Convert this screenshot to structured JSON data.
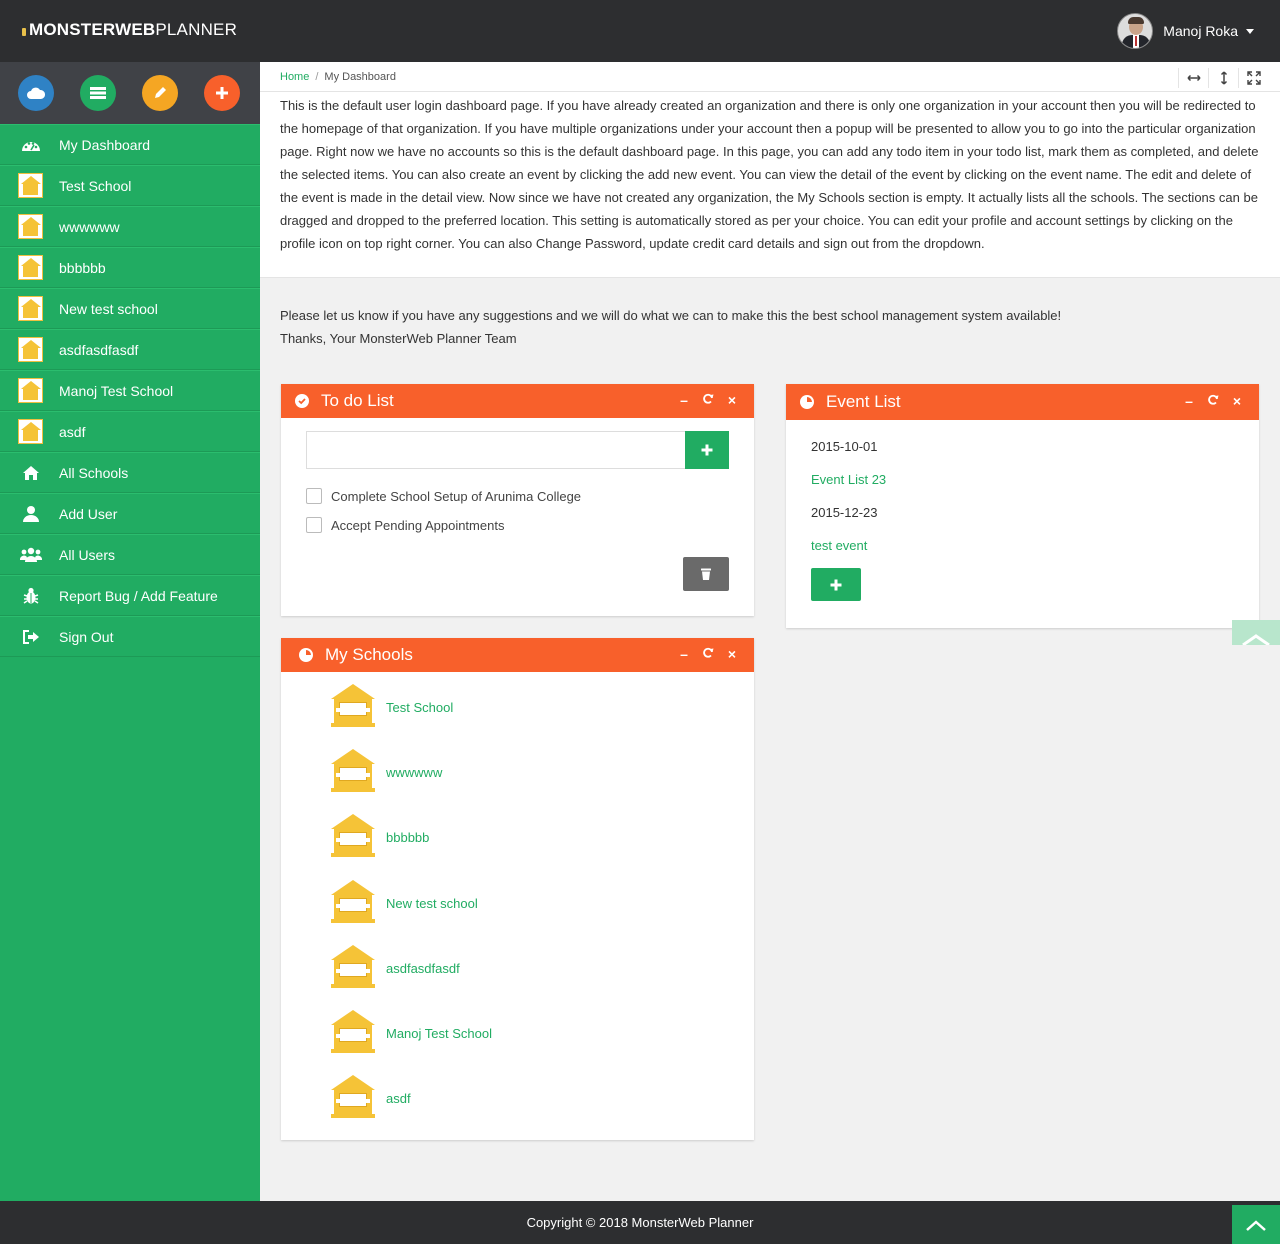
{
  "app": {
    "logo_bold": "MONSTERWEB",
    "logo_light": "PLANNER"
  },
  "user": {
    "name": "Manoj Roka"
  },
  "quick_actions": [
    {
      "name": "cloud",
      "color": "#2f82c5"
    },
    {
      "name": "storage",
      "color": "#21ac62"
    },
    {
      "name": "edit",
      "color": "#f5a623"
    },
    {
      "name": "add",
      "color": "#f8602b"
    }
  ],
  "sidebar": {
    "items": [
      {
        "label": "My Dashboard",
        "icon": "dashboard-icon"
      },
      {
        "label": "Test School",
        "icon": "school-icon"
      },
      {
        "label": "wwwwww",
        "icon": "school-icon"
      },
      {
        "label": "bbbbbb",
        "icon": "school-icon"
      },
      {
        "label": "New test school",
        "icon": "school-icon"
      },
      {
        "label": "asdfasdfasdf",
        "icon": "school-icon"
      },
      {
        "label": "Manoj Test School",
        "icon": "school-icon"
      },
      {
        "label": "asdf",
        "icon": "school-icon"
      },
      {
        "label": "All Schools",
        "icon": "home-icon"
      },
      {
        "label": "Add User",
        "icon": "user-icon"
      },
      {
        "label": "All Users",
        "icon": "users-icon"
      },
      {
        "label": "Report Bug / Add Feature",
        "icon": "bug-icon"
      },
      {
        "label": "Sign Out",
        "icon": "sign-out-icon"
      }
    ]
  },
  "breadcrumb": {
    "home": "Home",
    "current": "My Dashboard",
    "separator": "/"
  },
  "intro": {
    "text": "This is the default user login dashboard page. If you have already created an organization and there is only one organization in your account then you will be redirected to the homepage of that organization. If you have multiple organizations under your account then a popup will be presented to allow you to go into the particular organization page. Right now we have no accounts so this is the default dashboard page. In this page, you can add any todo item in your todo list, mark them as completed, and delete the selected items. You can also create an event by clicking the add new event. You can view the detail of the event by clicking on the event name. The edit and delete of the event is made in the detail view. Now since we have not created any organization, the My Schools section is empty. It actually lists all the schools. The sections can be dragged and dropped to the preferred location. This setting is automatically stored as per your choice. You can edit your profile and account settings by clicking on the profile icon on top right corner. You can also Change Password, update credit card details and sign out from the dropdown.",
    "suggestions": "Please let us know if you have any suggestions and we will do what we can to make this the best school management system available!",
    "signoff": "Thanks, Your MonsterWeb Planner Team"
  },
  "todo": {
    "title": "To do List",
    "input_value": "",
    "items": [
      "Complete School Setup of Arunima College",
      "Accept Pending Appointments"
    ]
  },
  "events": {
    "title": "Event List",
    "items": [
      {
        "date": "2015-10-01",
        "name": "Event List 23"
      },
      {
        "date": "2015-12-23",
        "name": "test event"
      }
    ]
  },
  "schools": {
    "title": "My Schools",
    "items": [
      "Test School",
      "wwwwww",
      "bbbbbb",
      "New test school",
      "asdfasdfasdf",
      "Manoj Test School",
      "asdf"
    ]
  },
  "panel_controls": {
    "minimize": "–",
    "close": "×"
  },
  "footer": {
    "text": "Copyright © 2018 MonsterWeb Planner"
  }
}
